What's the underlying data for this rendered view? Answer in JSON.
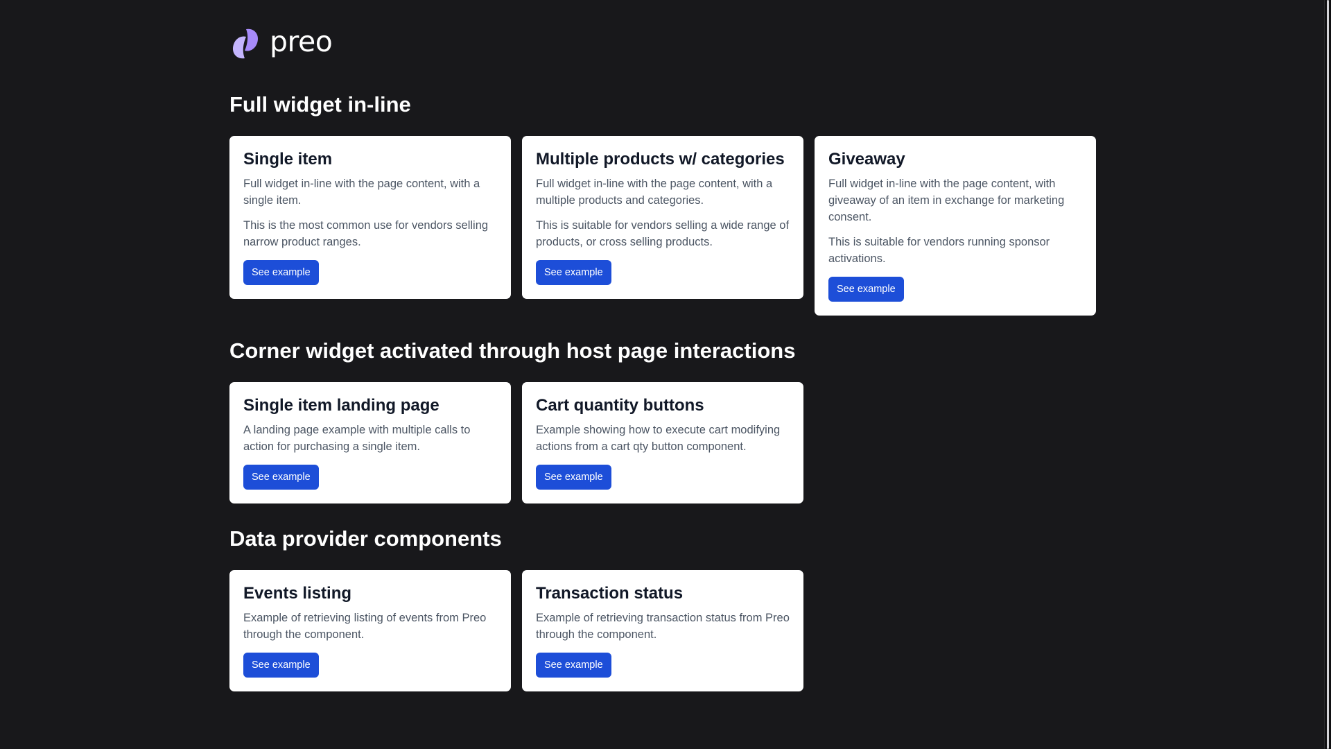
{
  "brand": {
    "name": "preo",
    "accent": "#a78bfa"
  },
  "sections": [
    {
      "title": "Full widget in-line",
      "cards": [
        {
          "title": "Single item",
          "paragraphs": [
            "Full widget in-line with the page content, with a single item.",
            "This is the most common use for vendors selling narrow product ranges."
          ],
          "button": "See example"
        },
        {
          "title": "Multiple products w/ categories",
          "paragraphs": [
            "Full widget in-line with the page content, with a multiple products and categories.",
            "This is suitable for vendors selling a wide range of products, or cross selling products."
          ],
          "button": "See example"
        },
        {
          "title": "Giveaway",
          "paragraphs": [
            "Full widget in-line with the page content, with giveaway of an item in exchange for marketing consent.",
            "This is suitable for vendors running sponsor activations."
          ],
          "button": "See example"
        }
      ]
    },
    {
      "title": "Corner widget activated through host page interactions",
      "cards": [
        {
          "title": "Single item landing page",
          "paragraphs": [
            "A landing page example with multiple calls to action for purchasing a single item."
          ],
          "button": "See example"
        },
        {
          "title": "Cart quantity buttons",
          "paragraphs": [
            "Example showing how to execute cart modifying actions from a cart qty button component."
          ],
          "button": "See example"
        }
      ]
    },
    {
      "title": "Data provider components",
      "cards": [
        {
          "title": "Events listing",
          "paragraphs": [
            "Example of retrieving listing of events from Preo through the component."
          ],
          "button": "See example"
        },
        {
          "title": "Transaction status",
          "paragraphs": [
            "Example of retrieving transaction status from Preo through the component."
          ],
          "button": "See example"
        }
      ]
    }
  ],
  "colors": {
    "background": "#18181b",
    "card": "#ffffff",
    "button": "#1d4ed8",
    "heading": "#ffffff"
  }
}
